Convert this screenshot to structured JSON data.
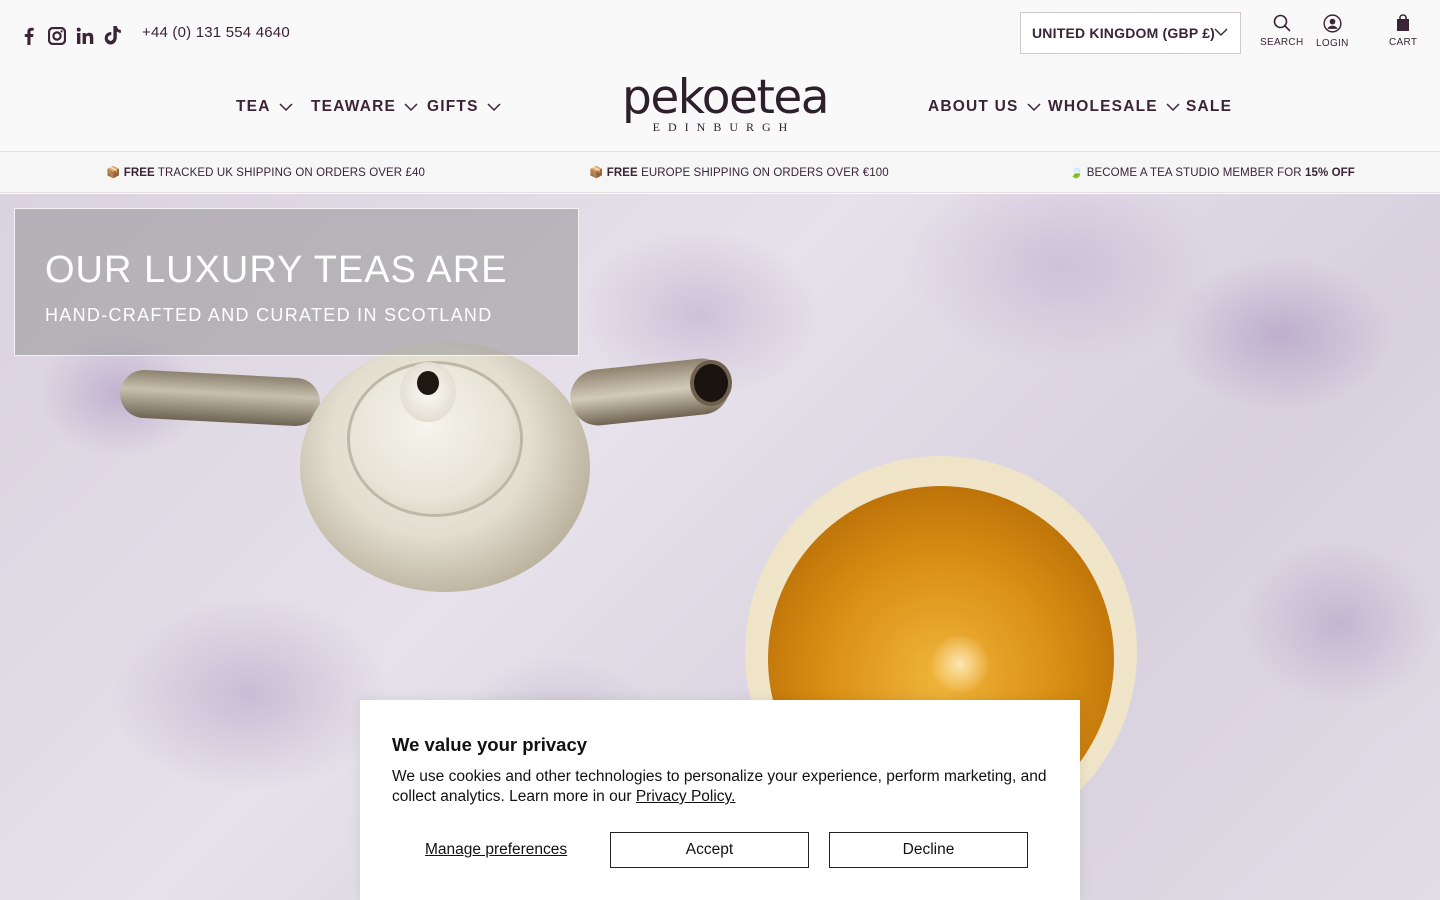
{
  "header": {
    "phone": "+44 (0) 131 554 4640",
    "social": [
      "facebook-icon",
      "instagram-icon",
      "linkedin-icon",
      "tiktok-icon"
    ],
    "country_selector": "UNITED KINGDOM (GBP £)",
    "search_label": "SEARCH",
    "login_label": "LOGIN",
    "cart_label": "CART"
  },
  "nav": {
    "left": [
      "TEA",
      "TEAWARE",
      "GIFTS"
    ],
    "right": [
      "ABOUT US",
      "WHOLESALE",
      "SALE"
    ]
  },
  "logo": {
    "wordmark": "pekoetea",
    "city": "EDINBURGH"
  },
  "announcements": [
    {
      "icon": "📦",
      "bold": "FREE",
      "text": " TRACKED UK SHIPPING ON ORDERS OVER £40",
      "tail": ""
    },
    {
      "icon": "📦",
      "bold": "FREE",
      "text": " EUROPE SHIPPING ON ORDERS OVER €100",
      "tail": ""
    },
    {
      "icon": "🍃",
      "bold": "",
      "text": " BECOME A TEA STUDIO MEMBER FOR ",
      "tail": "15% OFF"
    }
  ],
  "hero": {
    "title": "OUR LUXURY TEAS ARE",
    "subtitle": "HAND-CRAFTED AND CURATED IN SCOTLAND"
  },
  "cookie": {
    "title": "We value your privacy",
    "text": "We use cookies and other technologies to personalize your experience, perform marketing, and collect analytics. Learn more in our",
    "link": "Privacy Policy.",
    "manage": "Manage preferences",
    "accept": "Accept",
    "decline": "Decline"
  },
  "colors": {
    "text": "#3a2436",
    "background": "#faf9f9",
    "tea": "#d98f14"
  }
}
